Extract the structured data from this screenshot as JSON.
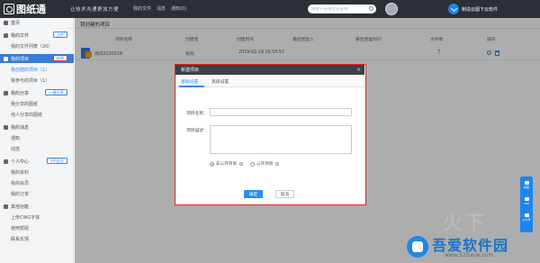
{
  "header": {
    "logo_text": "图纸通",
    "slogan": "让技术沟通更加方便",
    "nav": [
      "我的文件",
      "消息",
      "通知(0)"
    ],
    "search_placeholder": "搜索人员或企业名称",
    "download_label": "制造云图下云软件"
  },
  "sidebar": {
    "items": [
      {
        "label": "首页"
      },
      {
        "label": "我的文件",
        "btn": "上传"
      },
      {
        "label": "我的文件列表（20）"
      },
      {
        "label": "我的项目",
        "btn": "新建"
      },
      {
        "label": "我创建的项目（1）"
      },
      {
        "label": "我参与的项目（1）"
      },
      {
        "label": "我的分享",
        "btn": "一键分享"
      },
      {
        "label": "我分享的图纸"
      },
      {
        "label": "他人分享的图纸"
      },
      {
        "label": "我的消息"
      },
      {
        "label": "通知"
      },
      {
        "label": "动态"
      },
      {
        "label": "个人中心",
        "btn": "VIP会员"
      },
      {
        "label": "我的资料"
      },
      {
        "label": "我的会员"
      },
      {
        "label": "我的订单"
      },
      {
        "label": "其他功能"
      },
      {
        "label": "上传CWG字体"
      },
      {
        "label": "使用帮助"
      },
      {
        "label": "联系反馈"
      }
    ]
  },
  "main": {
    "title": "我创建的项目",
    "columns": [
      "项目名称",
      "创建者",
      "创建时间",
      "最后回复人",
      "最后回复时间",
      "文件数",
      "操作"
    ],
    "rows": [
      {
        "name": "测试2220219",
        "creator": "张剑",
        "created": "2019-02-19 10:16:57",
        "last_replier": "",
        "last_reply_time": "",
        "file_count": "7"
      }
    ]
  },
  "modal": {
    "title": "新建项目",
    "close": "×",
    "tabs": [
      "基础设置",
      "高级设置"
    ],
    "name_label": "项目名称：",
    "name_value": "",
    "desc_label": "项目描述：",
    "desc_value": "",
    "radio_nonpublic": "非公开项目",
    "radio_public": "公开项目",
    "ok_label": "确定",
    "cancel_label": "取消"
  },
  "float_bar": {
    "items": [
      "客服",
      "APP",
      "公众号"
    ]
  },
  "watermark": {
    "text": "吾爱软件园",
    "url": "www.52zixue.com",
    "faded": "火下"
  }
}
